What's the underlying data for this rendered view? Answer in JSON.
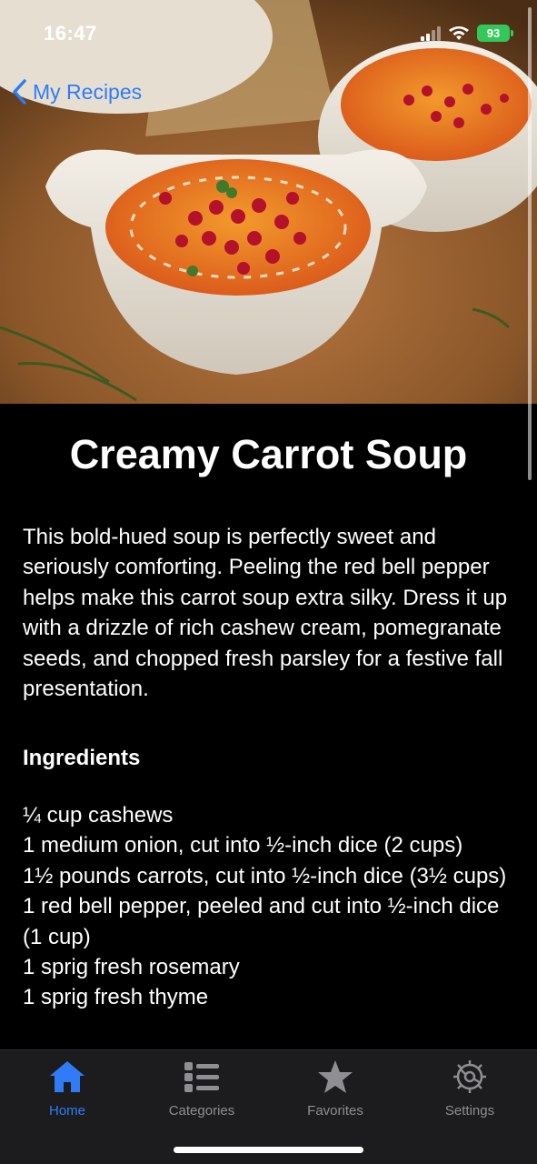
{
  "status_bar": {
    "time": "16:47",
    "battery": "93",
    "battery_color": "#34c759",
    "icons": [
      "signal-icon",
      "wifi-icon",
      "battery-icon"
    ]
  },
  "nav": {
    "back_label": "My Recipes",
    "back_icon": "chevron-left-icon",
    "accent_color": "#2f7cf6"
  },
  "recipe": {
    "title": "Creamy Carrot Soup",
    "description": "This bold-hued soup is perfectly sweet and seriously comforting. Peeling the red bell pepper helps make this carrot soup extra silky. Dress it up with a drizzle of rich cashew cream, pomegranate seeds, and chopped fresh parsley for a festive fall presentation.",
    "ingredients_heading": "Ingredients",
    "ingredients": [
      "¼ cup cashews",
      "1 medium onion, cut into ½-inch dice (2 cups)",
      "1½ pounds carrots, cut into ½-inch dice (3½ cups)",
      "1 red bell pepper, peeled and cut into ½-inch dice (1 cup)",
      "1 sprig fresh rosemary",
      "1 sprig fresh thyme"
    ]
  },
  "tab_bar": {
    "tabs": [
      {
        "label": "Home",
        "icon": "house-icon",
        "active": true
      },
      {
        "label": "Categories",
        "icon": "list-icon",
        "active": false
      },
      {
        "label": "Favorites",
        "icon": "star-icon",
        "active": false
      },
      {
        "label": "Settings",
        "icon": "gear-icon",
        "active": false
      }
    ],
    "active_color": "#2f7cf6",
    "inactive_color": "#8e8e93"
  }
}
